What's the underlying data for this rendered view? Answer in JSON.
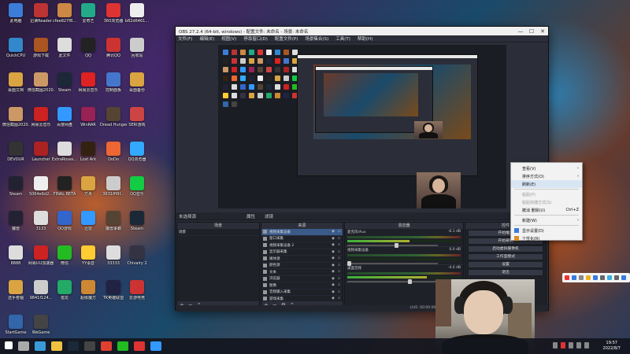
{
  "desktop": {
    "icons": [
      {
        "label": "此电脑",
        "color": "#3b7dd8"
      },
      {
        "label": "迅读Reader",
        "color": "#b33"
      },
      {
        "label": "cfee827f8...",
        "color": "#c84"
      },
      {
        "label": "爱奇艺",
        "color": "#2a8"
      },
      {
        "label": "360浏览器",
        "color": "#d33"
      },
      {
        "label": "b82d6461...",
        "color": "#eee"
      },
      {
        "label": "QuickCPU",
        "color": "#38c"
      },
      {
        "label": "游戏下载",
        "color": "#a52"
      },
      {
        "label": "此文件",
        "color": "#ddd"
      },
      {
        "label": "QQ",
        "color": "#222"
      },
      {
        "label": "腾讯QQ",
        "color": "#c33"
      },
      {
        "label": "回收站",
        "color": "#ccc"
      },
      {
        "label": "桌面文档",
        "color": "#d9a441"
      },
      {
        "label": "微信截图2020...",
        "color": "#c96"
      },
      {
        "label": "Steam",
        "color": "#1b2838"
      },
      {
        "label": "网易云音乐",
        "color": "#d22"
      },
      {
        "label": "控制面板",
        "color": "#47c"
      },
      {
        "label": "桌面备份",
        "color": "#d9a441"
      },
      {
        "label": "微信截图2020...",
        "color": "#c96"
      },
      {
        "label": "网易云音乐",
        "color": "#c22"
      },
      {
        "label": "百度网盘",
        "color": "#39f"
      },
      {
        "label": "WinRAR",
        "color": "#925"
      },
      {
        "label": "Dread Hunger",
        "color": "#543"
      },
      {
        "label": "SERI游戏",
        "color": "#c44"
      },
      {
        "label": "DEVOUR",
        "color": "#333"
      },
      {
        "label": "Launcher",
        "color": "#a22"
      },
      {
        "label": "ExtraRoses...",
        "color": "#ddd"
      },
      {
        "label": "Lost Ark",
        "color": "#321"
      },
      {
        "label": "DoDo",
        "color": "#e63"
      },
      {
        "label": "QQ浏览器",
        "color": "#3af"
      },
      {
        "label": "Steam",
        "color": "#223"
      },
      {
        "label": "5064e6d2...",
        "color": "#eee"
      },
      {
        "label": "FINAL BETA",
        "color": "#222"
      },
      {
        "label": "方舟",
        "color": "#d9a441"
      },
      {
        "label": "3631fff9f...",
        "color": "#ccc"
      },
      {
        "label": "QQ音乐",
        "color": "#1c4"
      },
      {
        "label": "魔兽",
        "color": "#223"
      },
      {
        "label": "3133",
        "color": "#ddd"
      },
      {
        "label": "QQ游戏",
        "color": "#36c"
      },
      {
        "label": "迅雷",
        "color": "#39f"
      },
      {
        "label": "魔兽争霸",
        "color": "#543"
      },
      {
        "label": "Steam",
        "color": "#1b2838"
      },
      {
        "label": "8888",
        "color": "#ddd"
      },
      {
        "label": "网易UU加速器",
        "color": "#c22"
      },
      {
        "label": "微信",
        "color": "#2b2"
      },
      {
        "label": "YY语音",
        "color": "#fc3"
      },
      {
        "label": "33333",
        "color": "#ddd"
      },
      {
        "label": "Chivalry 2",
        "color": "#334"
      },
      {
        "label": "选手卷轴",
        "color": "#d9a441"
      },
      {
        "label": "9841f124...",
        "color": "#ccc"
      },
      {
        "label": "猎龙",
        "color": "#2a6"
      },
      {
        "label": "超级魔方",
        "color": "#c83"
      },
      {
        "label": "TK英雄联盟",
        "color": "#224"
      },
      {
        "label": "爱游电竞",
        "color": "#c33"
      },
      {
        "label": "StartGame",
        "color": "#36a"
      },
      {
        "label": "WeGame",
        "color": "#444"
      }
    ]
  },
  "obs": {
    "title": "OBS 27.2.4 (64-bit, windows) - 配置文件: 未命名 - 场景: 未命名",
    "menu": [
      "文件(F)",
      "编辑(E)",
      "视图(V)",
      "停靠窗口(D)",
      "配置文件(P)",
      "场景集合(S)",
      "工具(T)",
      "帮助(H)"
    ],
    "window_controls": [
      "—",
      "☐",
      "✕"
    ],
    "scene_label": "未选择源",
    "top_buttons": [
      "属性",
      "滤镜"
    ],
    "docks": {
      "scenes": {
        "title": "场景",
        "items": [
          "场景"
        ]
      },
      "sources": {
        "title": "来源",
        "items": [
          "视频采集设备",
          "窗口采集",
          "视频采集设备 2",
          "显示器采集",
          "媒体源",
          "颜色源",
          "文本",
          "浏览器",
          "图像",
          "音频输入采集",
          "游戏采集"
        ]
      },
      "mixer": {
        "title": "混音器",
        "channels": [
          {
            "name": "麦克风/Aux",
            "db": "-6.1 dB",
            "level": 0.55
          },
          {
            "name": "视频采集设备",
            "db": "0.0 dB",
            "level": 0.0
          },
          {
            "name": "桌面音频",
            "db": "-4.4 dB",
            "level": 0.7
          }
        ]
      },
      "transitions": {
        "title": "转场动画"
      },
      "controls": {
        "title": "控件",
        "buttons": [
          "开始推流",
          "开始录制",
          "启动虚拟摄像机",
          "工作室模式",
          "设置",
          "退出"
        ]
      }
    },
    "status": "LIVE: 00:00:00   REC: 00:00:00   CPU: 1.1%, 30.00 fps"
  },
  "context_menu": {
    "items": [
      {
        "label": "查看(V)",
        "submenu": true,
        "disabled": false,
        "shortcut": ""
      },
      {
        "label": "排序方式(O)",
        "submenu": true,
        "disabled": false,
        "shortcut": ""
      },
      {
        "label": "刷新(E)",
        "submenu": false,
        "disabled": false,
        "shortcut": "",
        "highlight": true
      },
      {
        "label": "粘贴(P)",
        "submenu": false,
        "disabled": true,
        "shortcut": ""
      },
      {
        "label": "粘贴快捷方式(S)",
        "submenu": false,
        "disabled": true,
        "shortcut": ""
      },
      {
        "label": "撤消 删除(U)",
        "submenu": false,
        "disabled": false,
        "shortcut": "Ctrl+Z"
      },
      {
        "label": "新建(W)",
        "submenu": true,
        "disabled": false,
        "shortcut": ""
      },
      {
        "label": "显示设置(D)",
        "submenu": false,
        "disabled": false,
        "shortcut": ""
      },
      {
        "label": "个性化(R)",
        "submenu": false,
        "disabled": false,
        "shortcut": ""
      }
    ]
  },
  "taskbar": {
    "time": "19:57",
    "date": "2022/8/7",
    "apps": [
      "start-icon",
      "search-icon",
      "edge-icon",
      "explorer-icon",
      "steam-icon",
      "obs-icon",
      "chrome-icon",
      "wechat-icon",
      "media-icon",
      "browser-icon"
    ]
  }
}
